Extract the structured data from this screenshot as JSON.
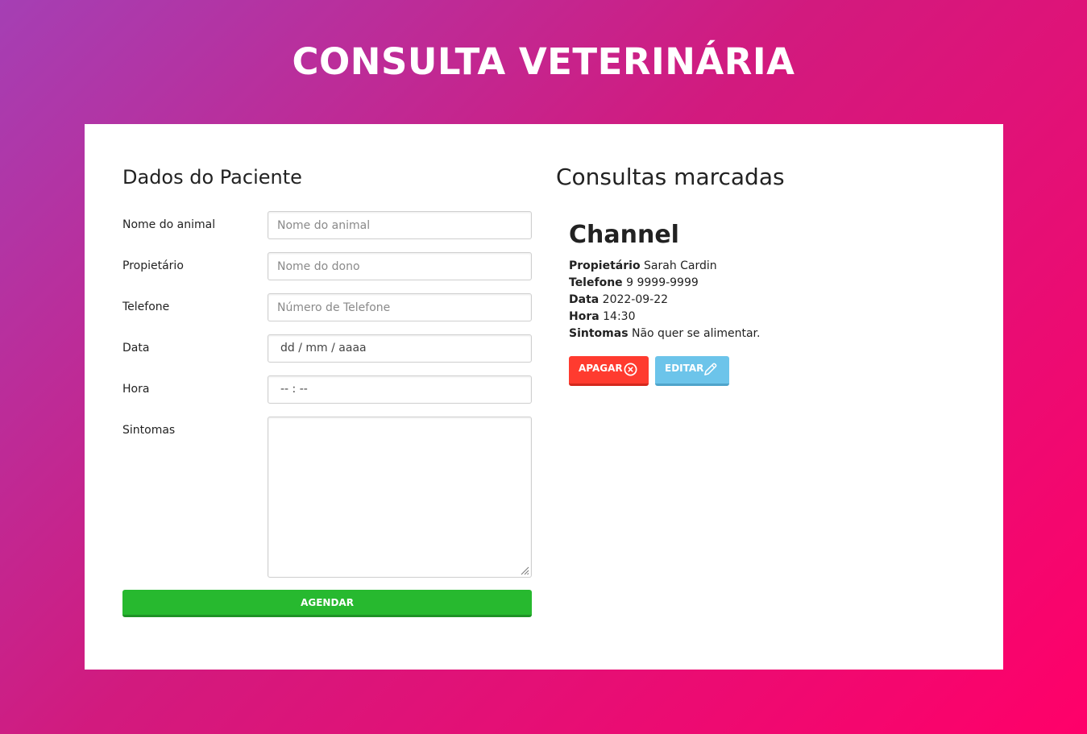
{
  "page": {
    "title": "CONSULTA VETERINÁRIA"
  },
  "form": {
    "title": "Dados do Paciente",
    "fields": [
      {
        "label": "Nome do animal",
        "placeholder": "Nome do animal",
        "value": ""
      },
      {
        "label": "Propietário",
        "placeholder": "Nome do dono",
        "value": ""
      },
      {
        "label": "Telefone",
        "placeholder": "Número de Telefone",
        "value": ""
      },
      {
        "label": "Data",
        "placeholder": "dd / mm / aaaa",
        "value": ""
      },
      {
        "label": "Hora",
        "placeholder": "-- : --",
        "value": ""
      },
      {
        "label": "Sintomas",
        "placeholder": "",
        "value": ""
      }
    ],
    "submit_label": "AGENDAR"
  },
  "appointments": {
    "title": "Consultas marcadas",
    "items": [
      {
        "pet_name": "Channel",
        "owner_label": "Propietário",
        "owner": "Sarah Cardin",
        "phone_label": "Telefone",
        "phone": "9 9999-9999",
        "date_label": "Data",
        "date": "2022-09-22",
        "time_label": "Hora",
        "time": "14:30",
        "symptoms_label": "Sintomas",
        "symptoms": "Não quer se alimentar.",
        "delete_label": "APAGAR",
        "edit_label": "EDITAR"
      }
    ]
  },
  "icons": {
    "delete": "close-circle-icon",
    "edit": "pencil-icon",
    "resize": "resize-grip-icon"
  },
  "colors": {
    "gradient_start": "#a53fb4",
    "gradient_end": "#ff0069",
    "submit": "#27b92f",
    "delete": "#ff3b2f",
    "edit": "#6cc4ea"
  }
}
